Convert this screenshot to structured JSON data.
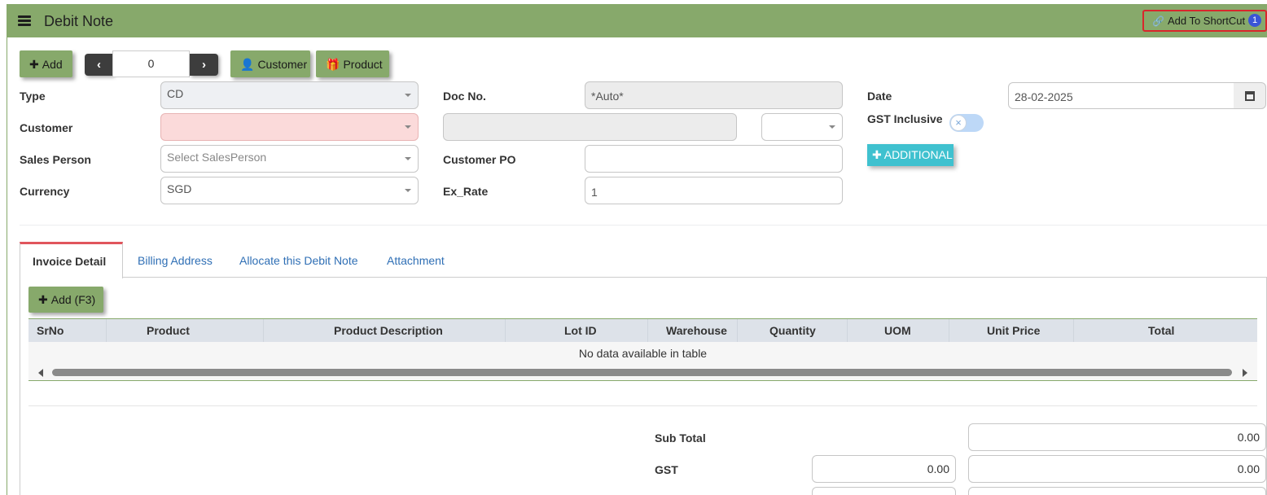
{
  "header": {
    "title": "Debit Note",
    "shortcut_label": "Add To ShortCut",
    "shortcut_badge": "1"
  },
  "toolbar": {
    "add_label": "Add",
    "record_index": "0",
    "customer_label": "Customer",
    "product_label": "Product"
  },
  "form": {
    "type_label": "Type",
    "type_value": "CD",
    "customer_label": "Customer",
    "customer_value": "",
    "sales_person_label": "Sales Person",
    "sales_person_placeholder": "Select SalesPerson",
    "currency_label": "Currency",
    "currency_value": "SGD",
    "doc_no_label": "Doc No.",
    "doc_no_value": "*Auto*",
    "customer_po_label": "Customer PO",
    "customer_po_value": "",
    "ex_rate_label": "Ex_Rate",
    "ex_rate_value": "1",
    "date_label": "Date",
    "date_value": "28-02-2025",
    "gst_inclusive_label": "GST Inclusive",
    "gst_inclusive_on": false,
    "additional_label": "ADDITIONAL"
  },
  "tabs": [
    {
      "label": "Invoice Detail",
      "active": true
    },
    {
      "label": "Billing Address",
      "active": false
    },
    {
      "label": "Allocate this Debit Note",
      "active": false
    },
    {
      "label": "Attachment",
      "active": false
    }
  ],
  "invoice_detail": {
    "add_label": "Add (F3)",
    "columns": [
      "SrNo",
      "Product",
      "Product Description",
      "Lot ID",
      "Warehouse",
      "Quantity",
      "UOM",
      "Unit Price",
      "Total"
    ],
    "empty_message": "No data available in table"
  },
  "totals": {
    "sub_total_label": "Sub Total",
    "sub_total_value": "0.00",
    "gst_label": "GST",
    "gst_rate_value": "0.00",
    "gst_value": "0.00"
  },
  "colors": {
    "header_bg": "#87a96b",
    "accent_blue": "#2f6fb5",
    "additional_btn": "#3fc1cf",
    "badge": "#3a55d6",
    "tab_active_border": "#e0555c"
  }
}
